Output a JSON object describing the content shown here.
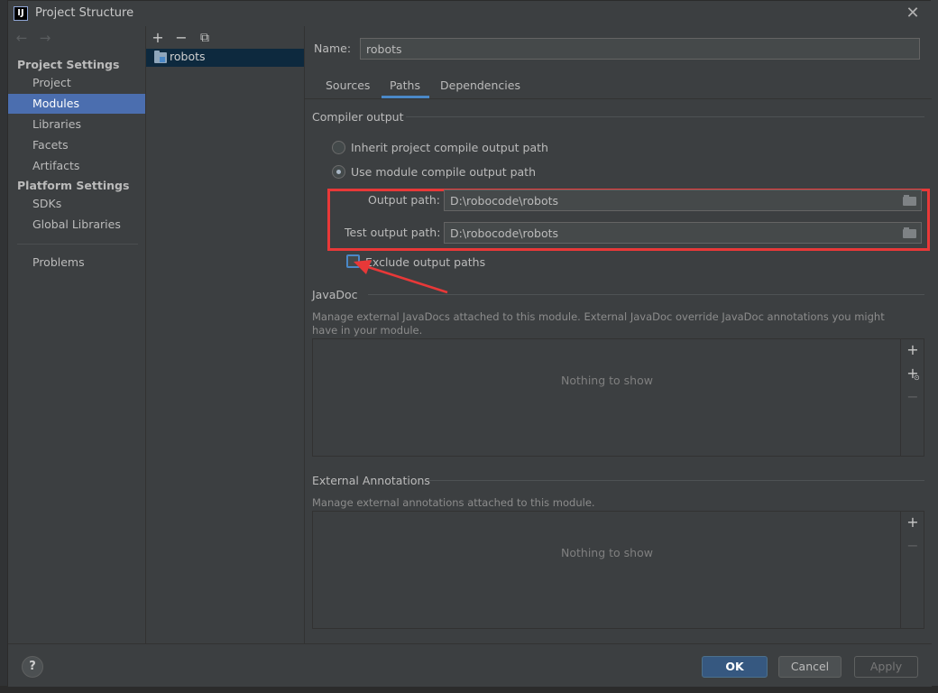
{
  "window": {
    "title": "Project Structure",
    "logo_text": "IJ",
    "close_glyph": "✕"
  },
  "sidebar": {
    "nav_back": "←",
    "nav_forward": "→",
    "project_settings_header": "Project Settings",
    "project_items": [
      "Project",
      "Modules",
      "Libraries",
      "Facets",
      "Artifacts"
    ],
    "platform_settings_header": "Platform Settings",
    "platform_items": [
      "SDKs",
      "Global Libraries"
    ],
    "problems": "Problems"
  },
  "modules": {
    "toolbar": {
      "add": "+",
      "remove": "−",
      "copy": "⧉"
    },
    "items": [
      "robots"
    ]
  },
  "main": {
    "name_label": "Name:",
    "name_value": "robots",
    "tabs": [
      "Sources",
      "Paths",
      "Dependencies"
    ],
    "active_tab": "Paths",
    "compiler_output": {
      "title": "Compiler output",
      "inherit_label": "Inherit project compile output path",
      "use_module_label": "Use module compile output path",
      "output_path_label": "Output path:",
      "output_path_value": "D:\\robocode\\robots",
      "test_output_path_label": "Test output path:",
      "test_output_path_value": "D:\\robocode\\robots",
      "exclude_label": "Exclude output paths"
    },
    "javadoc": {
      "title": "JavaDoc",
      "description": "Manage external JavaDocs attached to this module. External JavaDoc override JavaDoc annotations you might have in your module.",
      "empty_text": "Nothing to show"
    },
    "external_annotations": {
      "title": "External Annotations",
      "description": "Manage external annotations attached to this module.",
      "empty_text": "Nothing to show"
    }
  },
  "footer": {
    "help": "?",
    "ok": "OK",
    "cancel": "Cancel",
    "apply": "Apply"
  },
  "colors": {
    "accent": "#4a88c7",
    "highlight": "#e83838",
    "selected_bg": "#4b6eaf",
    "primary_button": "#365880"
  }
}
